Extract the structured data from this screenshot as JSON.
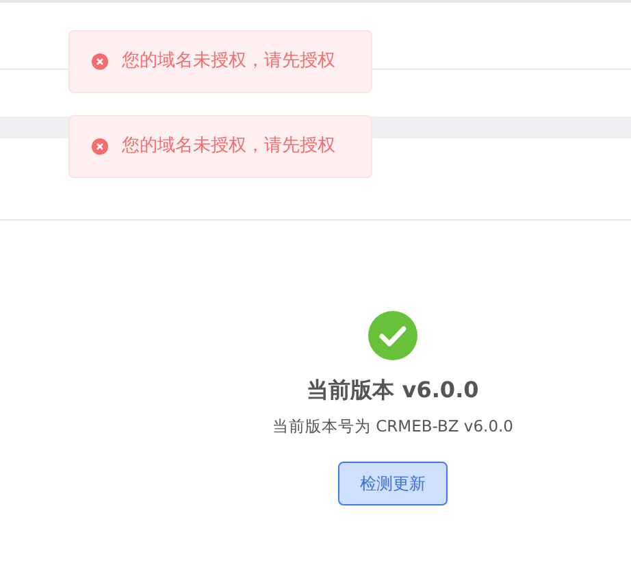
{
  "messages": [
    {
      "kind": "error",
      "text": "您的域名未授权，请先授权"
    },
    {
      "kind": "error",
      "text": "您的域名未授权，请先授权"
    }
  ],
  "version": {
    "kind": "success",
    "title": "当前版本 v6.0.0",
    "subtitle": "当前版本号为 CRMEB-BZ v6.0.0",
    "button": "检测更新"
  }
}
